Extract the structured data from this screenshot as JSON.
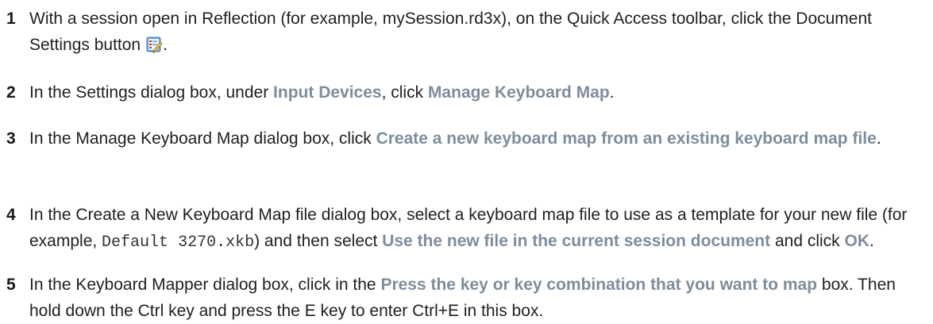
{
  "steps": [
    {
      "number": "1",
      "text_a": "With a session open in Reflection (for example, mySession.rd3x), on the Quick Access toolbar, click the Document Settings button",
      "text_b": ".",
      "icon": "document-settings-icon"
    },
    {
      "number": "2",
      "text_a": "In the Settings dialog box, under ",
      "ui_a": "Input Devices",
      "text_b": ", click ",
      "ui_b": "Manage Keyboard Map",
      "text_c": "."
    },
    {
      "number": "3",
      "text_a": "In the Manage Keyboard Map dialog box, click ",
      "ui_a": "Create a new keyboard map from an existing keyboard map file",
      "text_b": "."
    },
    {
      "number": "4",
      "text_a": "In the Create a New Keyboard Map file dialog box, select a keyboard map file to use as a template for your new file (for example, ",
      "code": "Default 3270.xkb",
      "text_b": ") and then select ",
      "ui_a": "Use the new file in the current session document",
      "text_c": " and click ",
      "ui_b": "OK",
      "text_d": "."
    },
    {
      "number": "5",
      "text_a": "In the Keyboard Mapper dialog box, click in the ",
      "ui_a": "Press the key or key combination that you want to map",
      "text_b": " box. Then hold down the Ctrl key and press the E key to enter Ctrl+E in this box."
    }
  ]
}
